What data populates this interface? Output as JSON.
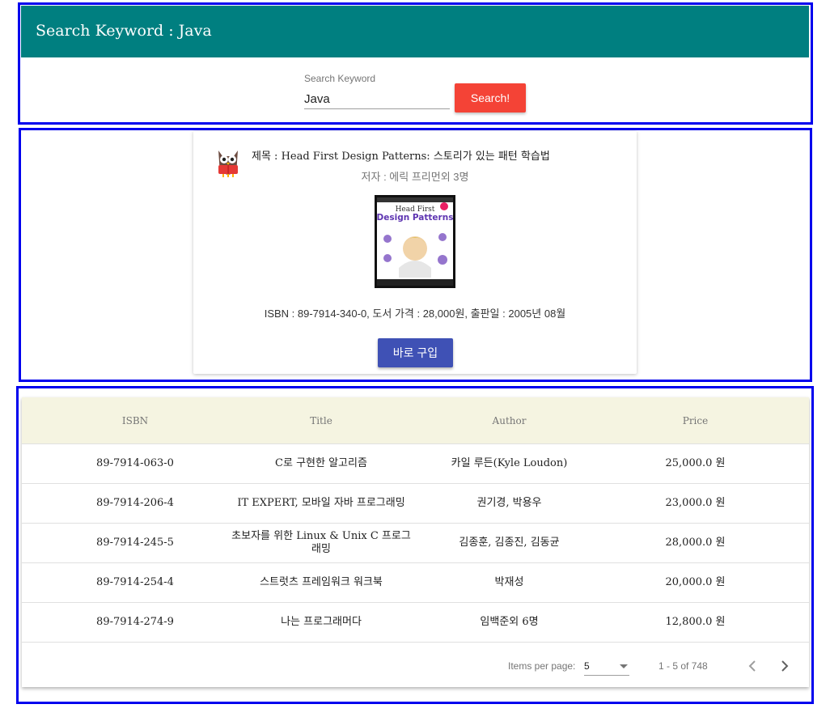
{
  "header": {
    "title": "Search Keyword : Java"
  },
  "search": {
    "label": "Search Keyword",
    "value": "Java",
    "button": "Search!"
  },
  "book": {
    "title": "제목 : Head First Design Patterns: 스토리가 있는 패턴 학습법",
    "author": "저자 : 에릭 프리먼외 3명",
    "cover": {
      "line1": "Head First",
      "line2": "Design Patterns"
    },
    "info": "ISBN : 89-7914-340-0, 도서 가격 : 28,000원, 출판일 : 2005년 08월",
    "buy_button": "바로 구입"
  },
  "table": {
    "headers": [
      "ISBN",
      "Title",
      "Author",
      "Price"
    ],
    "rows": [
      [
        "89-7914-063-0",
        "C로 구현한 알고리즘",
        "카일 루든(Kyle Loudon)",
        "25,000.0 원"
      ],
      [
        "89-7914-206-4",
        "IT EXPERT, 모바일 자바 프로그래밍",
        "권기경, 박용우",
        "23,000.0 원"
      ],
      [
        "89-7914-245-5",
        "초보자를 위한 Linux & Unix C 프로그래밍",
        "김종훈, 김종진, 김동균",
        "28,000.0 원"
      ],
      [
        "89-7914-254-4",
        "스트럿츠 프레임워크 워크북",
        "박재성",
        "20,000.0 원"
      ],
      [
        "89-7914-274-9",
        "나는 프로그래머다",
        "임백준외 6명",
        "12,800.0 원"
      ]
    ]
  },
  "paginator": {
    "label": "Items per page:",
    "page_size": "5",
    "range": "1 - 5 of 748"
  },
  "colors": {
    "header": "#007f80",
    "search_button": "#f44336",
    "buy_button": "#3f51b5",
    "table_header": "#f5f4e1",
    "frame": "#0000ee"
  }
}
